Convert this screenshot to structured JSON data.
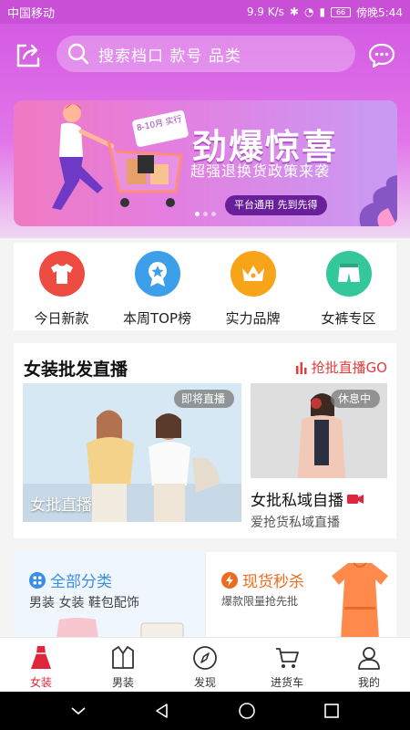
{
  "status_bar": {
    "carrier": "中国移动",
    "speed": "9.9 K/s",
    "battery": "66",
    "time": "傍晚5:44"
  },
  "header": {
    "search_placeholder": "搜索档口 款号 品类"
  },
  "banner": {
    "tag": "8-10月 实行",
    "title": "劲爆惊喜",
    "subtitle": "超强退换货政策来袭",
    "pill": "平台通用 先到先得"
  },
  "categories": [
    {
      "label": "今日新款",
      "icon": "tshirt-icon",
      "color": "#ee4b43"
    },
    {
      "label": "本周TOP榜",
      "icon": "ribbon-medal-icon",
      "color": "#3d9eea"
    },
    {
      "label": "实力品牌",
      "icon": "crown-icon",
      "color": "#f7a419"
    },
    {
      "label": "女裤专区",
      "icon": "shorts-icon",
      "color": "#34c79a"
    }
  ],
  "live_section": {
    "title": "女装批发直播",
    "link": "抢批直播GO",
    "main_card": {
      "badge": "即将直播",
      "caption": "女批直播"
    },
    "side_card": {
      "badge": "休息中",
      "title": "女批私域自播",
      "subtitle": "爱抢货私域直播"
    }
  },
  "promo": {
    "left": {
      "title": "全部分类",
      "subtitle": "男装 女装 鞋包配饰"
    },
    "right": {
      "title": "现货秒杀",
      "subtitle": "爆款限量抢先批"
    }
  },
  "tabs": [
    {
      "label": "女装",
      "icon": "dress-icon",
      "active": true
    },
    {
      "label": "男装",
      "icon": "shirt-icon",
      "active": false
    },
    {
      "label": "发现",
      "icon": "compass-icon",
      "active": false
    },
    {
      "label": "进货车",
      "icon": "cart-icon",
      "active": false
    },
    {
      "label": "我的",
      "icon": "user-icon",
      "active": false
    }
  ],
  "colors": {
    "header": "#d45be3",
    "accent_red": "#e0263c",
    "blue": "#3a8ee6",
    "orange": "#f06a1c"
  }
}
